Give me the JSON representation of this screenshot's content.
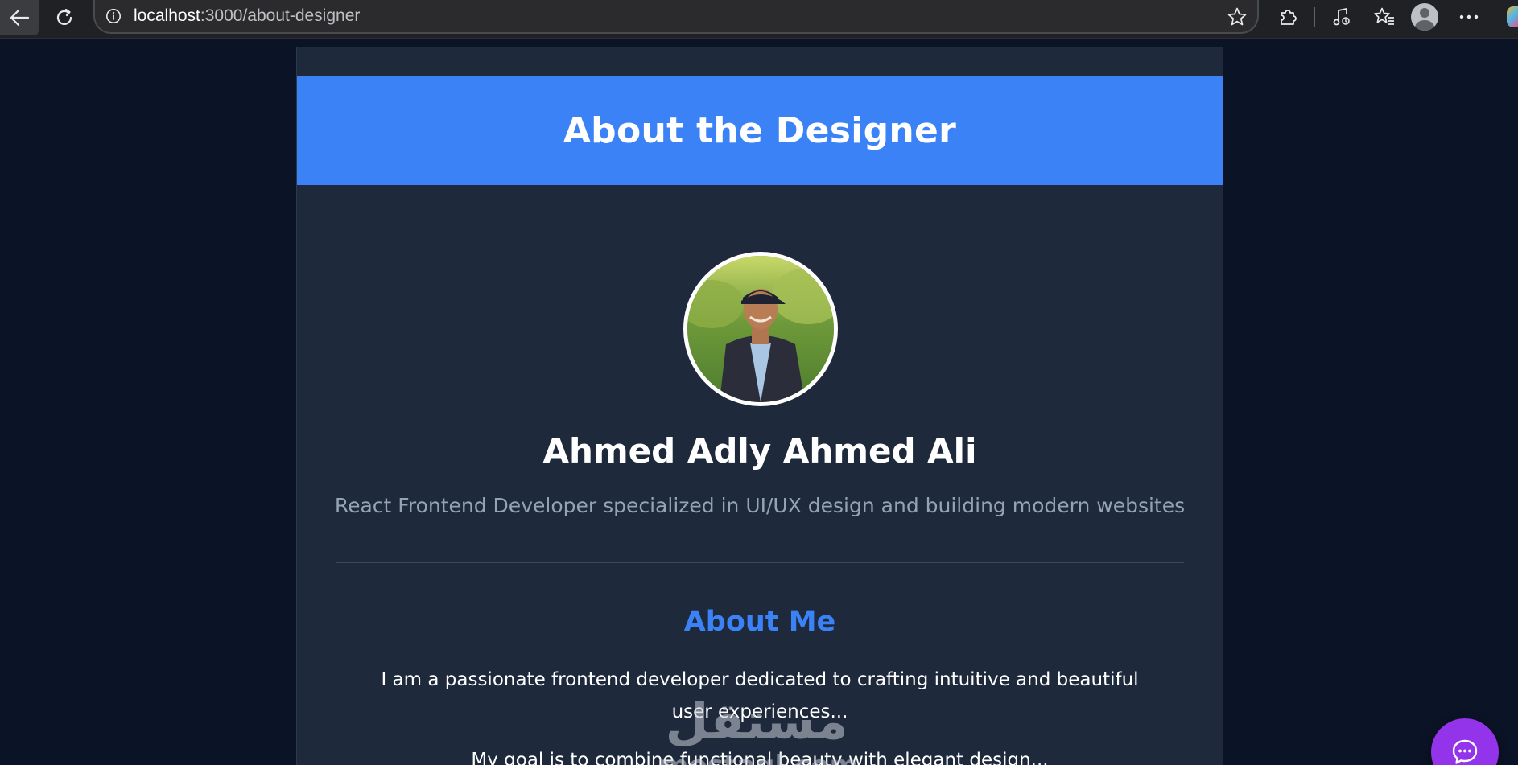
{
  "browser": {
    "url_host": "localhost",
    "url_rest": ":3000/about-designer"
  },
  "page": {
    "hero_title": "About the Designer",
    "name": "Ahmed Adly Ahmed Ali",
    "role": "React Frontend Developer specialized in UI/UX design and building modern websites",
    "section_title": "About Me",
    "about_paragraph": "I am a passionate frontend developer dedicated to crafting intuitive and beautiful user experiences...",
    "about_paragraph_2": "My goal is to combine functional beauty with elegant design..."
  },
  "watermark": {
    "arabic": "مستقل",
    "latin": "mostaql.com"
  },
  "icons": {
    "back": "arrow-left-icon",
    "reload": "reload-icon",
    "info": "info-icon",
    "star": "star-icon",
    "extensions": "puzzle-icon",
    "media": "music-note-icon",
    "favorites": "favorites-icon",
    "profile": "profile-icon",
    "more": "more-dots-icon",
    "chat": "chat-bubble-icon"
  },
  "colors": {
    "page_bg": "#0b1326",
    "card_bg": "#1e293b",
    "accent": "#3b82f6",
    "muted_text": "#94a3b8",
    "chat_fab": "#9333ea"
  }
}
